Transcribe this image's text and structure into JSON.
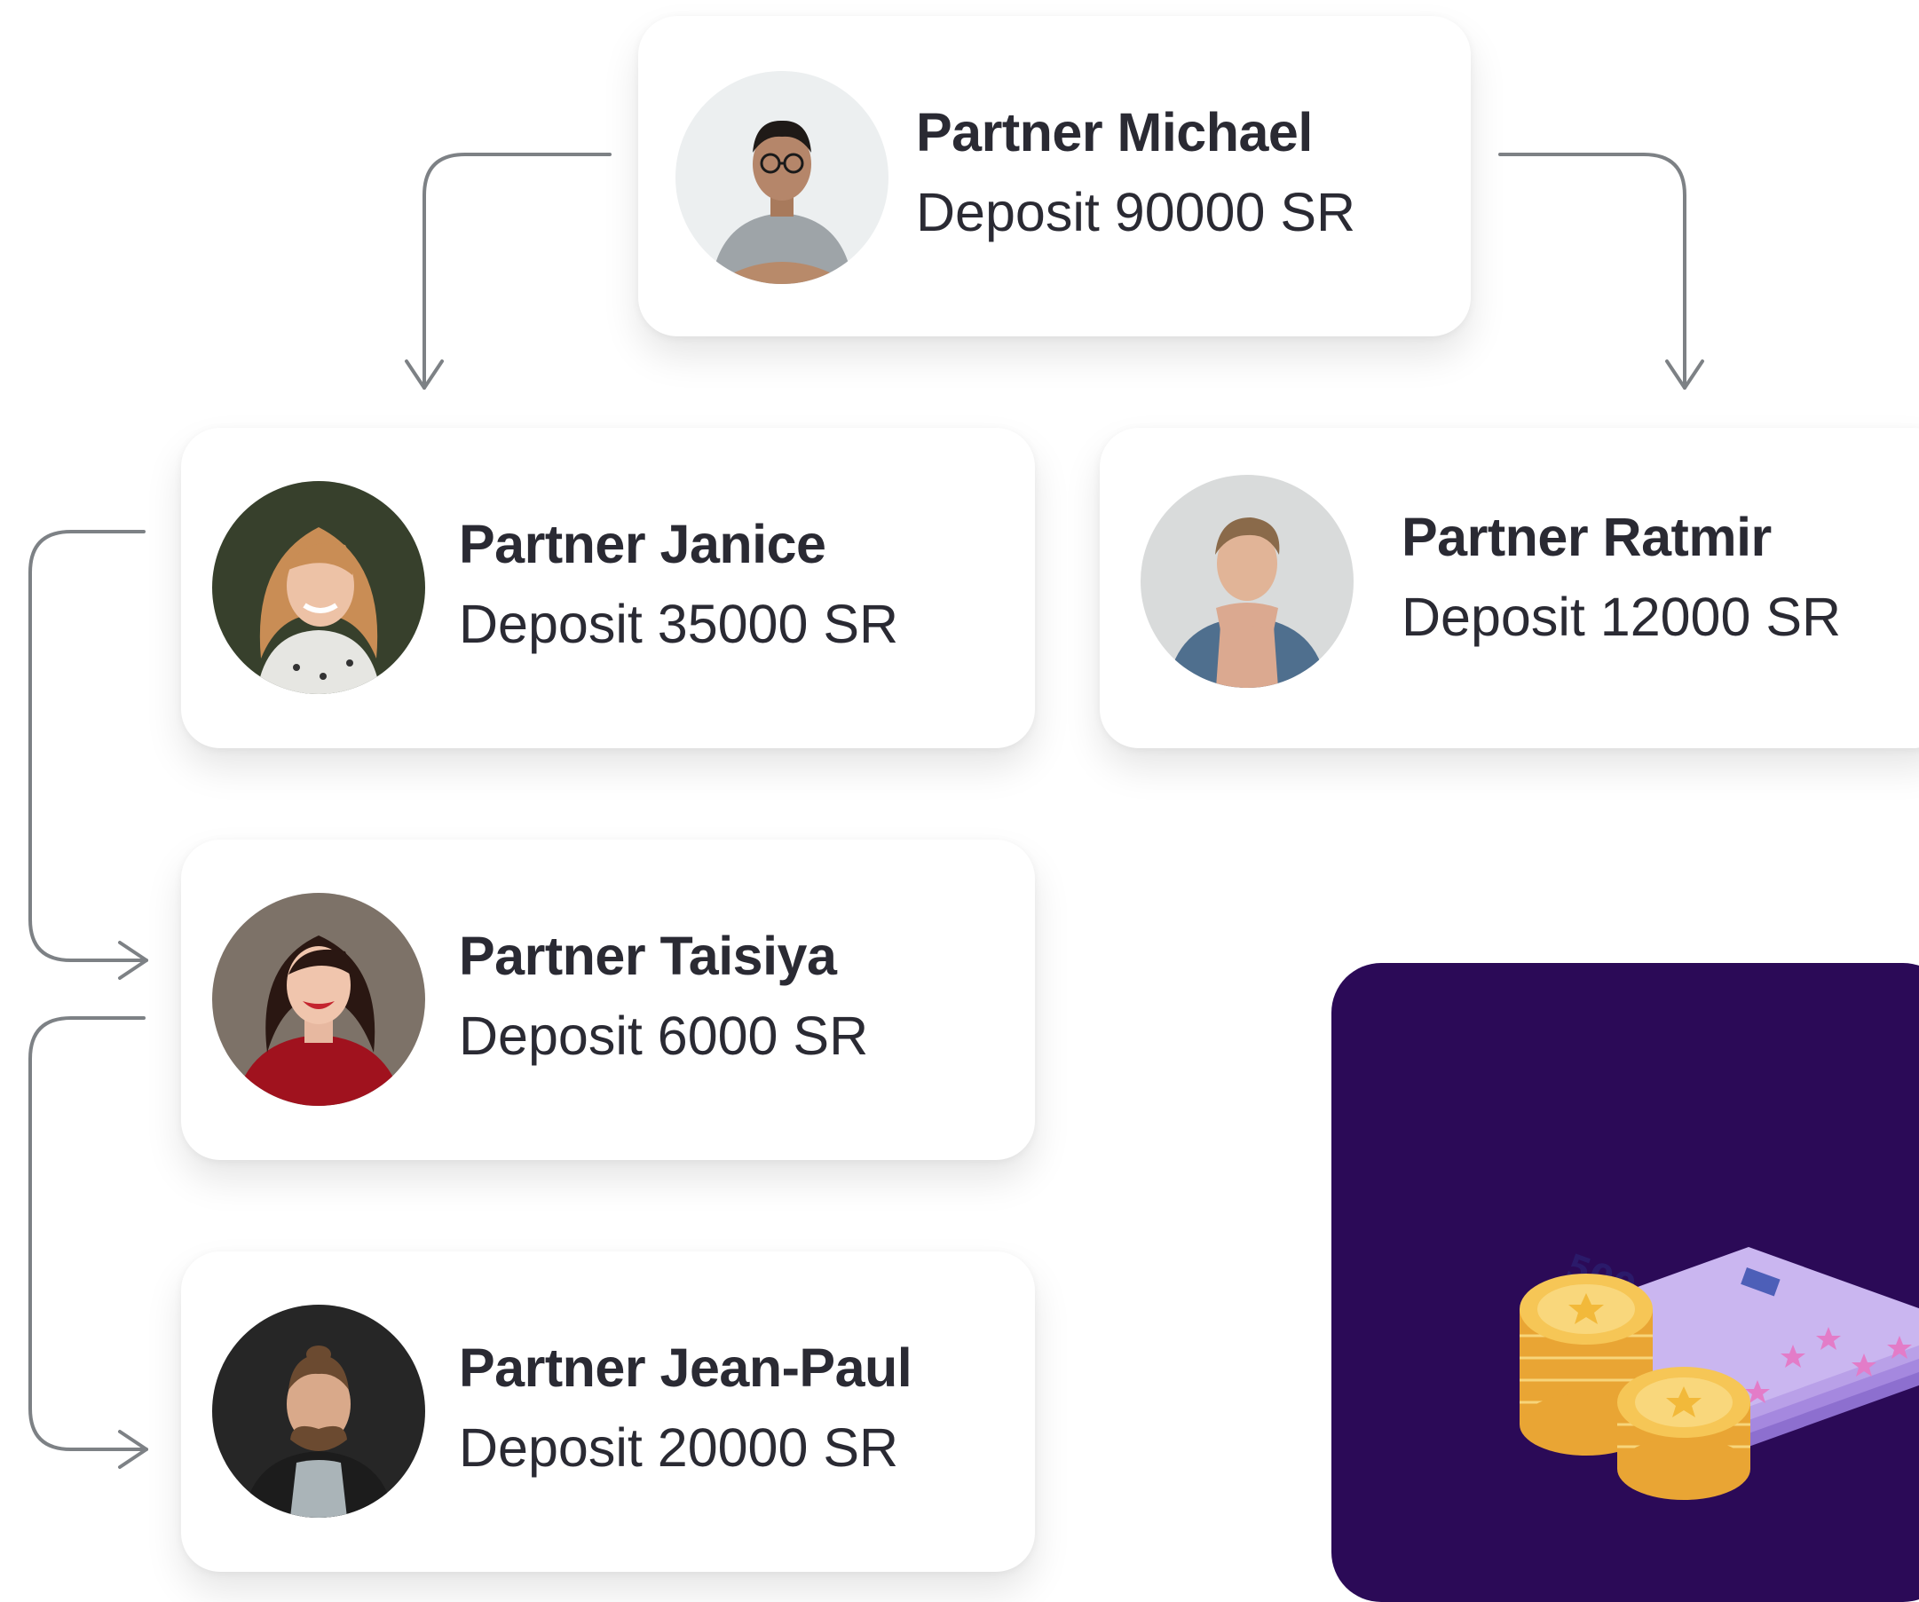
{
  "partners": {
    "michael": {
      "name": "Partner Michael",
      "deposit": "Deposit 90000 SR"
    },
    "janice": {
      "name": "Partner Janice",
      "deposit": "Deposit 35000 SR"
    },
    "ratmir": {
      "name": "Partner Ratmir",
      "deposit": "Deposit 12000 SR"
    },
    "taisiya": {
      "name": "Partner Taisiya",
      "deposit": "Deposit 6000 SR"
    },
    "jeanpaul": {
      "name": "Partner Jean-Paul",
      "deposit": "Deposit 20000 SR"
    }
  },
  "illustration": {
    "banknote_value": "500",
    "colors": {
      "background": "#2b0a57",
      "banknote": "#b9a0e8",
      "coin": "#f4c04f",
      "connector": "#7d8185",
      "text": "#2a2a33"
    }
  }
}
